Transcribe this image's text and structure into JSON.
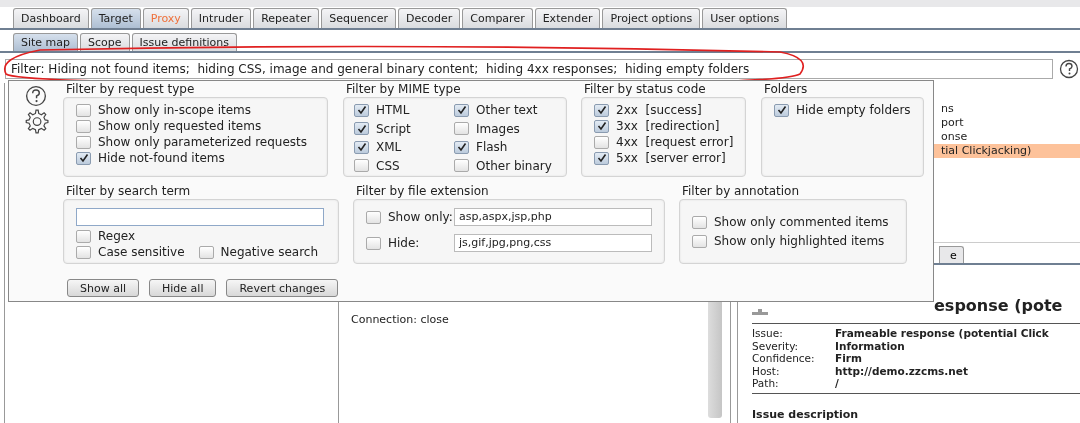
{
  "main_tabs": [
    {
      "label": "Dashboard",
      "selected": false,
      "highlighted": false
    },
    {
      "label": "Target",
      "selected": true,
      "highlighted": false
    },
    {
      "label": "Proxy",
      "selected": false,
      "highlighted": true
    },
    {
      "label": "Intruder",
      "selected": false,
      "highlighted": false
    },
    {
      "label": "Repeater",
      "selected": false,
      "highlighted": false
    },
    {
      "label": "Sequencer",
      "selected": false,
      "highlighted": false
    },
    {
      "label": "Decoder",
      "selected": false,
      "highlighted": false
    },
    {
      "label": "Comparer",
      "selected": false,
      "highlighted": false
    },
    {
      "label": "Extender",
      "selected": false,
      "highlighted": false
    },
    {
      "label": "Project options",
      "selected": false,
      "highlighted": false
    },
    {
      "label": "User options",
      "selected": false,
      "highlighted": false
    }
  ],
  "sub_tabs": [
    {
      "label": "Site map",
      "selected": true
    },
    {
      "label": "Scope",
      "selected": false
    },
    {
      "label": "Issue definitions",
      "selected": false
    }
  ],
  "filter_bar": {
    "text": "Filter: Hiding not found items;  hiding CSS, image and general binary content;  hiding 4xx responses;  hiding empty folders"
  },
  "issues_list": [
    {
      "text": "ns",
      "selected": false
    },
    {
      "text": "port",
      "selected": false
    },
    {
      "text": "onse",
      "selected": false
    },
    {
      "text": "tial Clickjacking)",
      "selected": true
    }
  ],
  "detail_tab": {
    "label": "e"
  },
  "request_lines": [
    "Connection: close"
  ],
  "issue_detail": {
    "heading": "esponse (pote",
    "fields": [
      {
        "label": "Issue:",
        "value": "Frameable response (potential Click"
      },
      {
        "label": "Severity:",
        "value": "Information"
      },
      {
        "label": "Confidence:",
        "value": "Firm"
      },
      {
        "label": "Host:",
        "value": "http://demo.zzcms.net"
      },
      {
        "label": "Path:",
        "value": "/"
      }
    ],
    "section": "Issue description"
  },
  "filter_popup": {
    "request_type": {
      "title": "Filter by request type",
      "options": [
        {
          "label": "Show only in-scope items",
          "checked": false
        },
        {
          "label": "Show only requested items",
          "checked": false
        },
        {
          "label": "Show only parameterized requests",
          "checked": false
        },
        {
          "label": "Hide not-found items",
          "checked": true
        }
      ]
    },
    "mime_type": {
      "title": "Filter by MIME type",
      "options": [
        {
          "label": "HTML",
          "checked": true
        },
        {
          "label": "Other text",
          "checked": true
        },
        {
          "label": "Script",
          "checked": true
        },
        {
          "label": "Images",
          "checked": false
        },
        {
          "label": "XML",
          "checked": true
        },
        {
          "label": "Flash",
          "checked": true
        },
        {
          "label": "CSS",
          "checked": false
        },
        {
          "label": "Other binary",
          "checked": false
        }
      ]
    },
    "status_code": {
      "title": "Filter by status code",
      "options": [
        {
          "label": "2xx  [success]",
          "checked": true
        },
        {
          "label": "3xx  [redirection]",
          "checked": true
        },
        {
          "label": "4xx  [request error]",
          "checked": false
        },
        {
          "label": "5xx  [server error]",
          "checked": true
        }
      ]
    },
    "folders": {
      "title": "Folders",
      "options": [
        {
          "label": "Hide empty folders",
          "checked": true
        }
      ]
    },
    "search_term": {
      "title": "Filter by search term",
      "options": [
        {
          "label": "Regex",
          "checked": false
        },
        {
          "label": "Case sensitive",
          "checked": false
        },
        {
          "label": "Negative search",
          "checked": false
        }
      ]
    },
    "file_extension": {
      "title": "Filter by file extension",
      "rows": [
        {
          "label": "Show only:",
          "checked": false,
          "value": "asp,aspx,jsp,php"
        },
        {
          "label": "Hide:",
          "checked": false,
          "value": "js,gif,jpg,png,css"
        }
      ]
    },
    "annotation": {
      "title": "Filter by annotation",
      "options": [
        {
          "label": "Show only commented items",
          "checked": false
        },
        {
          "label": "Show only highlighted items",
          "checked": false
        }
      ]
    },
    "buttons": [
      "Show all",
      "Hide all",
      "Revert changes"
    ]
  }
}
